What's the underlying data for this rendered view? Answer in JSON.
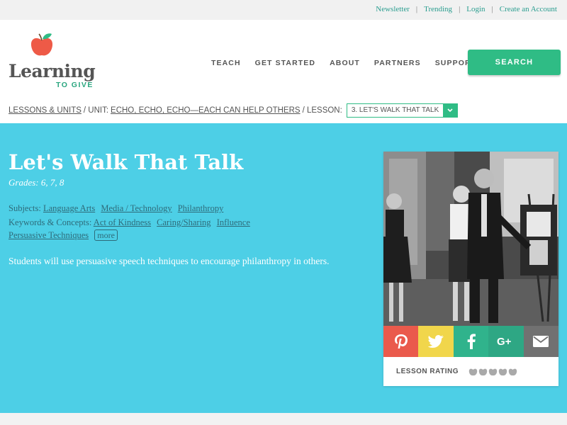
{
  "topbar": {
    "links": [
      "Newsletter",
      "Trending",
      "Login",
      "Create an Account"
    ],
    "separator": "|"
  },
  "logo": {
    "word": "Learning",
    "sub": "TO GIVE"
  },
  "nav": {
    "items": [
      "TEACH",
      "GET STARTED",
      "ABOUT",
      "PARTNERS",
      "SUPPORT US"
    ],
    "search_label": "SEARCH"
  },
  "breadcrumb": {
    "lessons_units": "LESSONS & UNITS",
    "sep1": "/ UNIT:",
    "unit": "ECHO, ECHO, ECHO—EACH CAN HELP OTHERS",
    "sep2": "/ LESSON:",
    "lesson_selected": "3. LET'S WALK THAT TALK"
  },
  "lesson": {
    "title": "Let's Walk That Talk",
    "grades": "Grades: 6, 7, 8",
    "subjects_label": "Subjects:",
    "subjects": [
      "Language Arts",
      "Media / Technology",
      "Philanthropy"
    ],
    "keywords_label": "Keywords & Concepts:",
    "keywords": [
      "Act of Kindness",
      "Caring/Sharing",
      "Influence",
      "Persuasive Techniques"
    ],
    "more_label": "more",
    "description": "Students will use persuasive speech techniques to encourage philanthropy in others."
  },
  "card": {
    "share_icons": [
      "pinterest-icon",
      "twitter-icon",
      "facebook-icon",
      "google-plus-icon",
      "email-icon"
    ],
    "rating_label": "LESSON RATING",
    "rating": 0,
    "rating_max": 5
  },
  "colors": {
    "accent_green": "#2fbc85",
    "hero_blue": "#4dcfe6",
    "link_teal": "#2a9d8f",
    "pinterest": "#ea5a4c",
    "twitter": "#f1d64b",
    "facebook": "#30b38c",
    "google_plus": "#2ea784",
    "email": "#717171"
  }
}
